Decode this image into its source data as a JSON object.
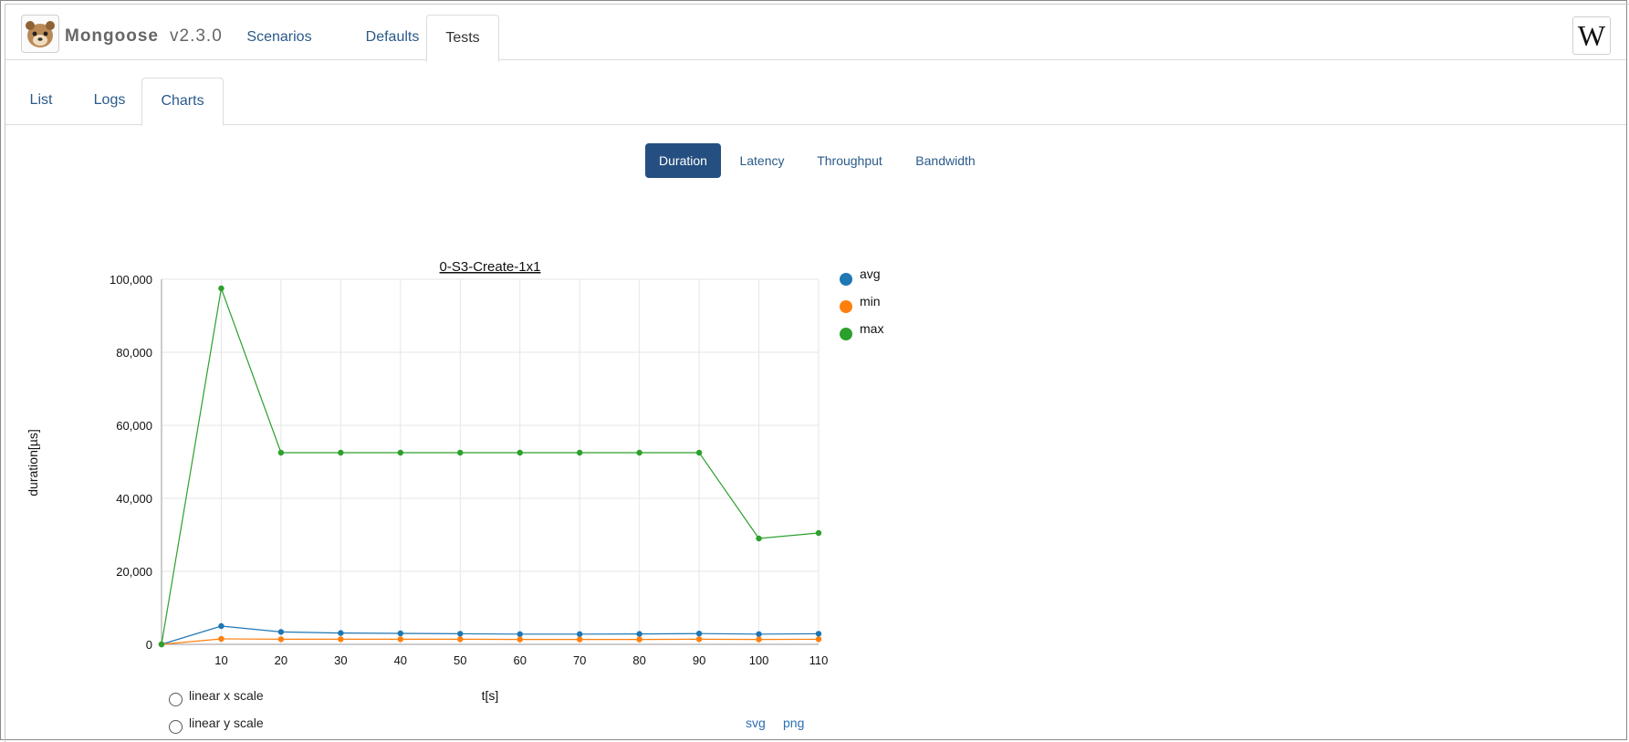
{
  "app": {
    "brand": "Mongoose",
    "version": "v2.3.0",
    "logo_icon": "mongoose-logo-icon",
    "wiki_label": "W"
  },
  "top_tabs": [
    {
      "label": "Scenarios",
      "active": false
    },
    {
      "label": "Defaults",
      "active": false
    },
    {
      "label": "Tests",
      "active": true
    }
  ],
  "sub_tabs": [
    {
      "label": "List",
      "active": false
    },
    {
      "label": "Logs",
      "active": false
    },
    {
      "label": "Charts",
      "active": true
    }
  ],
  "metric_tabs": [
    {
      "label": "Duration",
      "active": true
    },
    {
      "label": "Latency",
      "active": false
    },
    {
      "label": "Throughput",
      "active": false
    },
    {
      "label": "Bandwidth",
      "active": false
    }
  ],
  "controls": {
    "linear_x": "linear x scale",
    "linear_y": "linear y scale",
    "svg_link": "svg",
    "png_link": "png"
  },
  "colors": {
    "avg": "#1f77b4",
    "min": "#ff7f0e",
    "max": "#2ca02c",
    "accent": "#254f80"
  },
  "chart_data": {
    "type": "line",
    "title": "0-S3-Create-1x1",
    "xlabel": "t[s]",
    "ylabel": "duration[µs]",
    "x": [
      0,
      10,
      20,
      30,
      40,
      50,
      60,
      70,
      80,
      90,
      100,
      110
    ],
    "x_ticks": [
      10,
      20,
      30,
      40,
      50,
      60,
      70,
      80,
      90,
      100,
      110
    ],
    "y_ticks": [
      0,
      20000,
      40000,
      60000,
      80000,
      100000
    ],
    "y_tick_labels": [
      "0",
      "20,000",
      "40,000",
      "60,000",
      "80,000",
      "100,000"
    ],
    "xlim": [
      0,
      110
    ],
    "ylim": [
      0,
      100000
    ],
    "grid": true,
    "legend_position": "right",
    "series": [
      {
        "name": "avg",
        "values": [
          0,
          5000,
          3400,
          3100,
          3000,
          2900,
          2800,
          2800,
          2850,
          2950,
          2800,
          2900
        ]
      },
      {
        "name": "min",
        "values": [
          0,
          1500,
          1400,
          1400,
          1400,
          1400,
          1350,
          1350,
          1350,
          1400,
          1350,
          1400
        ]
      },
      {
        "name": "max",
        "values": [
          0,
          97500,
          52500,
          52500,
          52500,
          52500,
          52500,
          52500,
          52500,
          52500,
          29000,
          30500
        ]
      }
    ]
  }
}
